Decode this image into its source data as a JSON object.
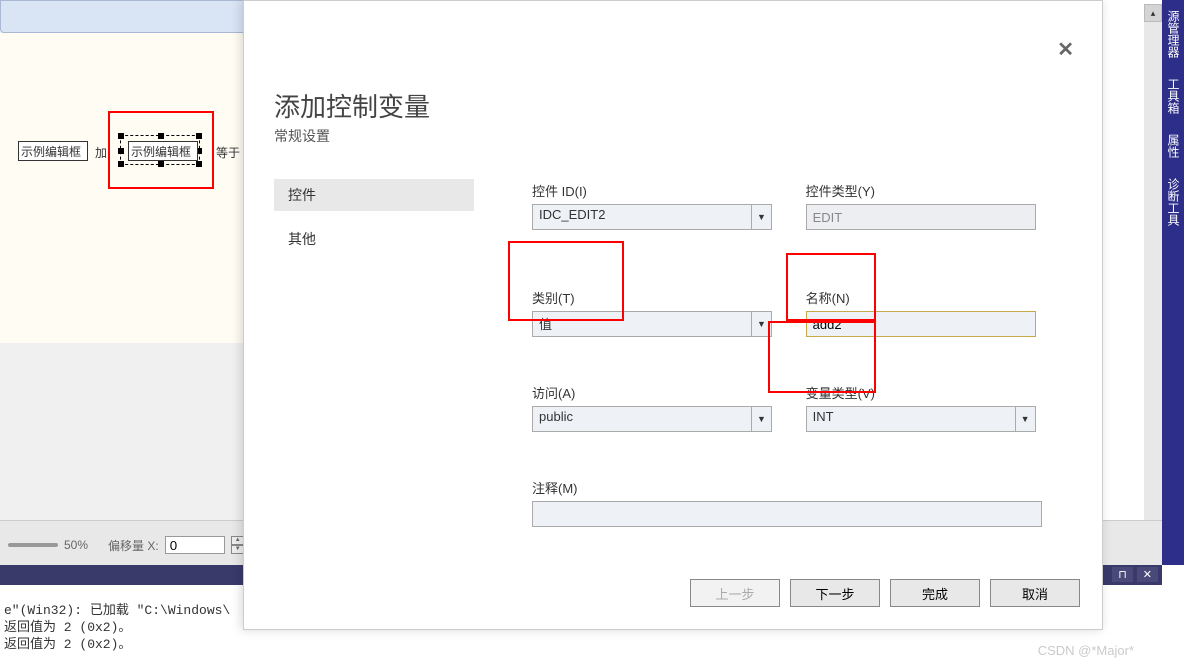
{
  "right_tabs": [
    "源管理器",
    "工具箱",
    "属性",
    "诊断工具"
  ],
  "design": {
    "sample_edit1": "示例编辑框",
    "plus_label": "加",
    "sample_edit2": "示例编辑框",
    "eq_label": "等于"
  },
  "zoom": {
    "pct": "50%",
    "offset_label": "偏移量 X:",
    "offset_value": "0"
  },
  "console": {
    "line1": "e\"(Win32): 已加载 \"C:\\Windows\\",
    "line2": "返回值为 2 (0x2)。",
    "line3": "返回值为 2 (0x2)。"
  },
  "modal": {
    "title": "添加控制变量",
    "subtitle": "常规设置",
    "nav": {
      "control": "控件",
      "other": "其他"
    },
    "labels": {
      "control_id": "控件 ID(I)",
      "control_type": "控件类型(Y)",
      "category": "类别(T)",
      "name": "名称(N)",
      "access": "访问(A)",
      "var_type": "变量类型(V)",
      "comment": "注释(M)"
    },
    "values": {
      "control_id": "IDC_EDIT2",
      "control_type": "EDIT",
      "category": "值",
      "name": "add2",
      "access": "public",
      "var_type": "INT",
      "comment": ""
    },
    "buttons": {
      "prev": "上一步",
      "next": "下一步",
      "finish": "完成",
      "cancel": "取消"
    }
  },
  "watermark": "CSDN @*Major*"
}
